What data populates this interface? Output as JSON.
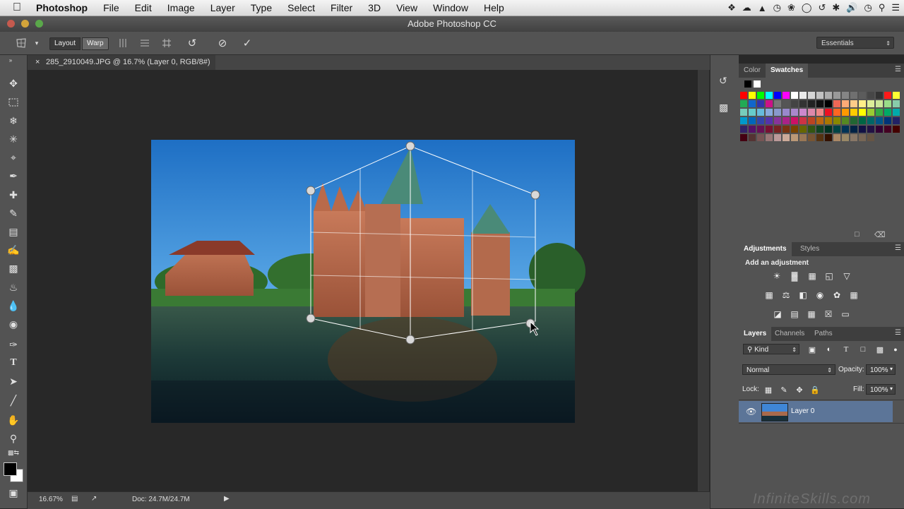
{
  "menubar": {
    "app": "Photoshop",
    "items": [
      "File",
      "Edit",
      "Image",
      "Layer",
      "Type",
      "Select",
      "Filter",
      "3D",
      "View",
      "Window",
      "Help"
    ]
  },
  "window": {
    "title": "Adobe Photoshop CC"
  },
  "options": {
    "layout_label": "Layout",
    "warp_label": "Warp",
    "workspace": "Essentials"
  },
  "document": {
    "tab_title": "285_2910049.JPG @ 16.7% (Layer 0, RGB/8#)",
    "tab_close": "×",
    "zoom": "16.67%",
    "doc_size": "Doc: 24.7M/24.7M"
  },
  "color_panel": {
    "tabs": [
      "Color",
      "Swatches"
    ],
    "active_tab": "Swatches"
  },
  "adjustments_panel": {
    "tabs": [
      "Adjustments",
      "Styles"
    ],
    "heading": "Add an adjustment"
  },
  "layers_panel": {
    "tabs": [
      "Layers",
      "Channels",
      "Paths"
    ],
    "filter_kind": "Kind",
    "blend_mode": "Normal",
    "opacity_label": "Opacity:",
    "opacity": "100%",
    "lock_label": "Lock:",
    "fill_label": "Fill:",
    "fill": "100%",
    "layers": [
      {
        "name": "Layer 0",
        "visible": true
      }
    ]
  },
  "watermark": "InfiniteSkills.com",
  "colors": {
    "accent": "#5c7598",
    "panel": "#535353",
    "canvas_bg": "#282828"
  },
  "swatches": {
    "rows": [
      [
        "#ff0000",
        "#ffff00",
        "#00ff00",
        "#00ffff",
        "#0000ff",
        "#ff00ff",
        "#ffffff",
        "#ebebeb",
        "#d6d6d6",
        "#c2c2c2",
        "#adadad",
        "#999999",
        "#858585",
        "#707070",
        "#5c5c5c",
        "#474747",
        "#333333",
        "#ff1a1a",
        "#ffff33"
      ],
      [
        "#22aa55",
        "#1166cc",
        "#3333aa",
        "#cc1188",
        "#777777",
        "#555555",
        "#444444",
        "#333333",
        "#222222",
        "#111111",
        "#000000",
        "#ee6655",
        "#ffaa77",
        "#ffcc88",
        "#ffee88",
        "#ddee99",
        "#cce699",
        "#99dd88",
        "#88ccaa"
      ],
      [
        "#77ccbb",
        "#66cccc",
        "#66bbdd",
        "#88aadd",
        "#8899cc",
        "#9988cc",
        "#aa88cc",
        "#cc88cc",
        "#dd88aa",
        "#ee8888",
        "#ee1122",
        "#ff6622",
        "#ff9900",
        "#ffcc00",
        "#ffff00",
        "#99cc33",
        "#33aa44",
        "#00aa66",
        "#00aaaa"
      ],
      [
        "#0099cc",
        "#0066bb",
        "#3344aa",
        "#5533aa",
        "#883399",
        "#aa2288",
        "#cc1166",
        "#cc3344",
        "#bb4422",
        "#bb6611",
        "#aa7700",
        "#888800",
        "#558822",
        "#226633",
        "#006644",
        "#006666",
        "#005588",
        "#003377",
        "#222266"
      ],
      [
        "#332266",
        "#551166",
        "#661155",
        "#771133",
        "#772222",
        "#773311",
        "#774400",
        "#666600",
        "#335511",
        "#114422",
        "#003322",
        "#004444",
        "#003355",
        "#002244",
        "#111144",
        "#221144",
        "#330033",
        "#440022",
        "#440000"
      ],
      [
        "#440011",
        "#553333",
        "#775555",
        "#997777",
        "#bb9999",
        "#ccaa99",
        "#bb9977",
        "#997755",
        "#775533",
        "#553311",
        "#331100",
        "#aa8866",
        "#998866",
        "#887766",
        "#776655",
        "#665544"
      ]
    ]
  }
}
